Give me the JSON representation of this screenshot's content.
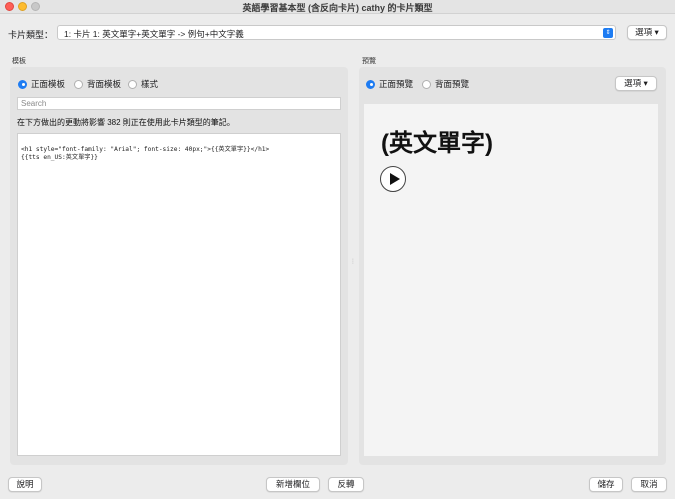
{
  "window": {
    "title": "英語學習基本型 (含反向卡片) cathy 的卡片類型"
  },
  "notetype": {
    "label": "卡片類型：",
    "selected": "1: 卡片 1: 英文單字+英文單字 -> 例句+中文字義",
    "options_button": "選項 ▾"
  },
  "template_panel": {
    "label": "模板",
    "radios": [
      {
        "label": "正面模板",
        "checked": true
      },
      {
        "label": "背面模板",
        "checked": false
      },
      {
        "label": "樣式",
        "checked": false
      }
    ],
    "search_placeholder": "Search",
    "info": "在下方做出的更動將影響 382 則正在使用此卡片類型的筆記。",
    "editor_content": "<h1 style=\"font-family: \"Arial\"; font-size: 40px;\">{{英文單字}}</h1>\n{{tts en_US:英文單字}}"
  },
  "preview_panel": {
    "label": "預覽",
    "radios": [
      {
        "label": "正面預覽",
        "checked": true
      },
      {
        "label": "背面預覽",
        "checked": false
      }
    ],
    "options_button": "選項 ▾",
    "heading": "(英文單字)",
    "play_icon": "play-circle-icon"
  },
  "footer": {
    "help": "說明",
    "add_field": "新增欄位",
    "flip": "反轉",
    "save": "儲存",
    "cancel": "取消"
  }
}
